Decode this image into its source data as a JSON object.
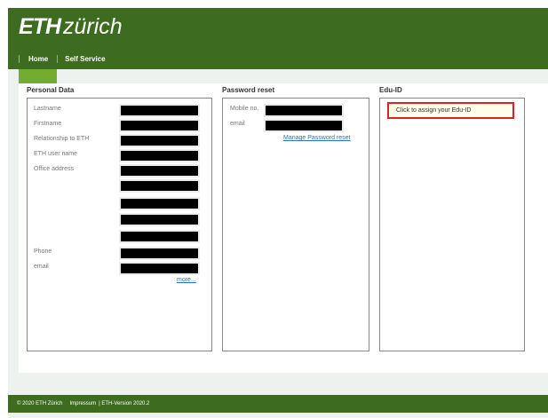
{
  "logo": {
    "eth": "ETH",
    "zurich": "zürich"
  },
  "nav": {
    "home": "Home",
    "self_service": "Self Service"
  },
  "personal": {
    "title": "Personal Data",
    "labels": [
      "Lastname",
      "Firstname",
      "Relationship to ETH",
      "ETH user name",
      "Office address",
      "Phone",
      "email"
    ],
    "more": "more..."
  },
  "password": {
    "title": "Password reset",
    "mobile_label": "Mobile no.",
    "email_label": "email",
    "manage_link": "Manage Password reset"
  },
  "eduid": {
    "title": "Edu-ID",
    "assign_button": "Click to assign your Edu-ID"
  },
  "footer": {
    "copyright": "© 2020 ETH Zürich",
    "impressum": "Impressum",
    "version": "| ETH-Version 2020.2"
  },
  "colors": {
    "brand": "#3d6b1f",
    "accent": "#72ad2e",
    "link": "#2a6fbf",
    "highlight": "#d8232a"
  }
}
